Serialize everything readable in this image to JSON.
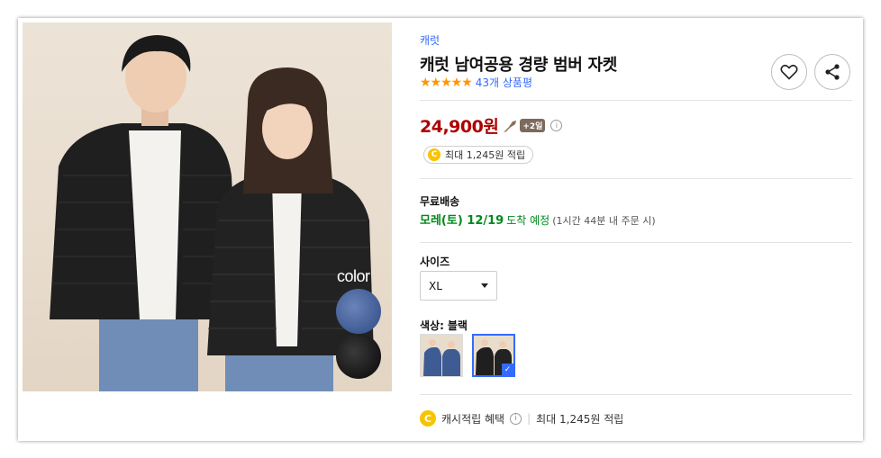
{
  "product": {
    "brand": "캐럿",
    "title": "캐럿 남여공용 경량 범버 자켓",
    "rating_stars": "★★★★★",
    "rating": 5,
    "review_count": "43개 상품평",
    "price": "24,900원",
    "rocket_badge": "+2일",
    "cash_back": "최대 1,245원 적립",
    "coin_glyph": "C"
  },
  "image": {
    "overlay_text": "color",
    "swatch_colors": [
      "#3f5b93",
      "#161616"
    ]
  },
  "shipping": {
    "label": "무료배송",
    "date": "모레(토) 12/19",
    "status": "도착 예정",
    "note": "(1시간 44분 내 주문 시)"
  },
  "options": {
    "size_label": "사이즈",
    "size_value": "XL",
    "color_label": "색상:",
    "color_value": "블랙",
    "color_thumbs": [
      {
        "name": "navy",
        "selected": false
      },
      {
        "name": "black",
        "selected": true
      }
    ]
  },
  "benefits": {
    "label": "캐시적립 혜택",
    "amount": "최대 1,245원 적립"
  },
  "icons": {
    "like": "heart-icon",
    "share": "share-icon",
    "info": "i",
    "check": "✓"
  },
  "colors": {
    "link_blue": "#346aff",
    "price_red": "#ae0000",
    "ship_green": "#00891a",
    "star_orange": "#ff9600",
    "coin_yellow": "#f7c400"
  }
}
